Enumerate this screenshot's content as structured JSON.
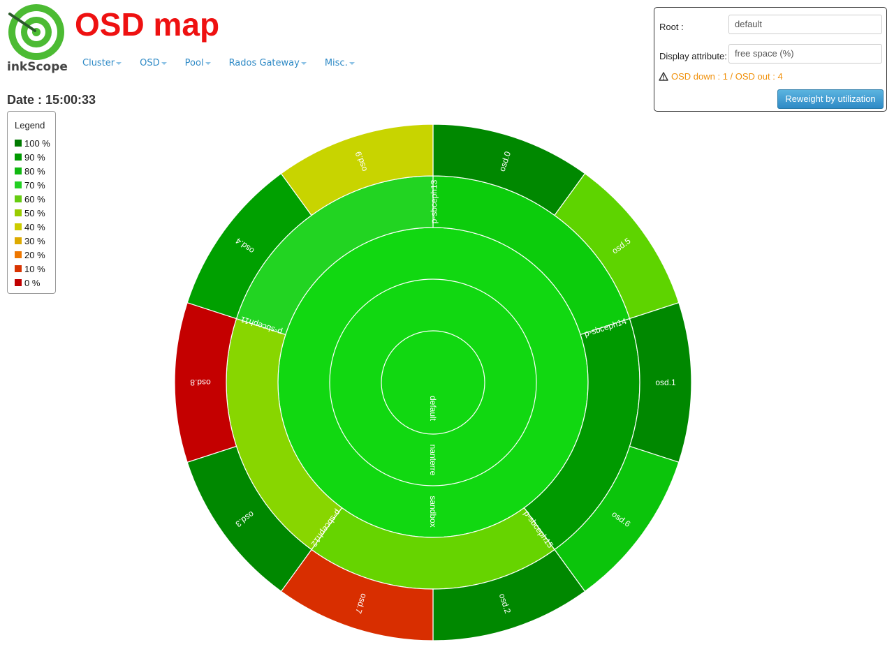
{
  "app": {
    "logo_text": "inkScope",
    "title": "OSD map"
  },
  "nav": [
    {
      "label": "Cluster"
    },
    {
      "label": "OSD"
    },
    {
      "label": "Pool"
    },
    {
      "label": "Rados Gateway"
    },
    {
      "label": "Misc."
    }
  ],
  "date": {
    "label": "Date : 15:00:33"
  },
  "legend": {
    "title": "Legend",
    "items": [
      {
        "label": "100 %",
        "color": "#007a00"
      },
      {
        "label": "90 %",
        "color": "#009900"
      },
      {
        "label": "80 %",
        "color": "#11b811"
      },
      {
        "label": "70 %",
        "color": "#22d022"
      },
      {
        "label": "60 %",
        "color": "#66cc11"
      },
      {
        "label": "50 %",
        "color": "#99cc00"
      },
      {
        "label": "40 %",
        "color": "#cccc00"
      },
      {
        "label": "30 %",
        "color": "#ddaa00"
      },
      {
        "label": "20 %",
        "color": "#ee7700"
      },
      {
        "label": "10 %",
        "color": "#d83300"
      },
      {
        "label": "0 %",
        "color": "#c00000"
      }
    ]
  },
  "controls": {
    "root_label": "Root :",
    "root_value": "default",
    "attr_label": "Display attribute:",
    "attr_value": "free space (%)",
    "status": "OSD down : 1 / OSD out : 4",
    "reweight_button": "Reweight by utilization"
  },
  "sunburst": {
    "ring1": {
      "label": "default",
      "color": "#11d811"
    },
    "ring2": {
      "label": "nanterre",
      "color": "#11d811"
    },
    "ring3": {
      "label": "sandbox",
      "color": "#11d811"
    },
    "hosts": [
      {
        "label": "p-sbceph13",
        "color": "#0ccc0c"
      },
      {
        "label": "p-sbceph14",
        "color": "#009a00"
      },
      {
        "label": "p-sbceph15",
        "color": "#66d400"
      },
      {
        "label": "p-sbceph12",
        "color": "#88d600"
      },
      {
        "label": "p-sbceph11",
        "color": "#22d422"
      }
    ],
    "osds": [
      {
        "label": "osd.0",
        "color": "#008800"
      },
      {
        "label": "osd.5",
        "color": "#5ed400"
      },
      {
        "label": "osd.1",
        "color": "#008800"
      },
      {
        "label": "osd.6",
        "color": "#0bc40b"
      },
      {
        "label": "osd.2",
        "color": "#008800"
      },
      {
        "label": "osd.7",
        "color": "#d82e00"
      },
      {
        "label": "osd.3",
        "color": "#008800"
      },
      {
        "label": "osd.8",
        "color": "#c40000"
      },
      {
        "label": "osd.4",
        "color": "#00a000"
      },
      {
        "label": "osd.9",
        "color": "#c8d400"
      }
    ]
  }
}
